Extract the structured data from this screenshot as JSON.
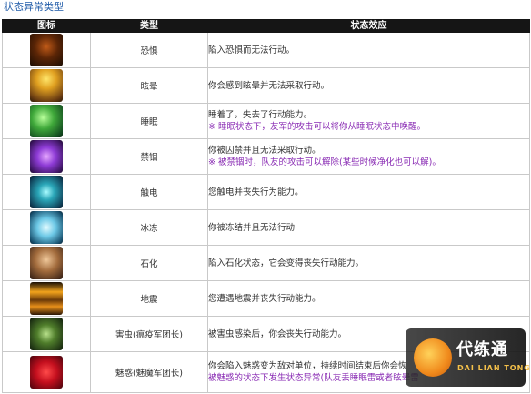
{
  "heading": "状态异常类型",
  "columns": {
    "icon": "图标",
    "type": "类型",
    "effect": "状态效应"
  },
  "rows": [
    {
      "type": "恐惧",
      "icon": "fear-icon",
      "effect": "陷入恐惧而无法行动。",
      "note": ""
    },
    {
      "type": "眩晕",
      "icon": "stun-icon",
      "effect": "你会感到眩晕并无法采取行动。",
      "note": ""
    },
    {
      "type": "睡眠",
      "icon": "sleep-icon",
      "effect": "睡着了，失去了行动能力。",
      "note": "※ 睡眠状态下，友军的攻击可以将你从睡眠状态中唤醒。"
    },
    {
      "type": "禁锢",
      "icon": "root-icon",
      "effect": "你被囚禁并且无法采取行动。",
      "note": "※ 被禁锢时，队友的攻击可以解除(某些时候净化也可以解)。"
    },
    {
      "type": "触电",
      "icon": "shock-icon",
      "effect": "您触电并丧失行为能力。",
      "note": ""
    },
    {
      "type": "冰冻",
      "icon": "freeze-icon",
      "effect": "你被冻结并且无法行动",
      "note": ""
    },
    {
      "type": "石化",
      "icon": "petrify-icon",
      "effect": "陷入石化状态，它会变得丧失行动能力。",
      "note": ""
    },
    {
      "type": "地震",
      "icon": "earthquake-icon",
      "effect": "您遭遇地震并丧失行动能力。",
      "note": ""
    },
    {
      "type": "害虫(瘟疫军团长)",
      "icon": "pest-icon",
      "effect": "被害虫感染后，你会丧失行动能力。",
      "note": ""
    },
    {
      "type": "魅惑(魅魔军团长)",
      "icon": "charm-icon",
      "effect": "你会陷入魅惑变为敌对单位，持续时间结束后你会恢",
      "note": "被魅惑的状态下发生状态异常(队友丢睡眠雷或者眩晕雷"
    }
  ],
  "watermark": {
    "cn": "代练通",
    "en": "DAI LIAN TONG"
  }
}
